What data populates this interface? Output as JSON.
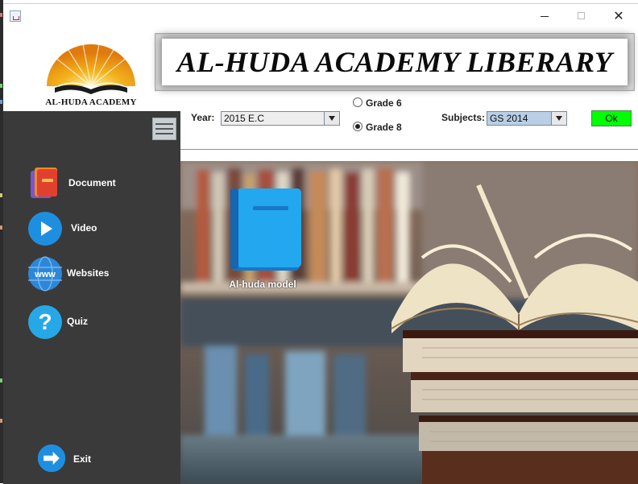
{
  "app": {
    "banner_title": "AL-HUDA ACADEMY LIBERARY",
    "logo_text": "AL-HUDA ACADEMY"
  },
  "window_controls": {
    "close_label": "✕"
  },
  "filters": {
    "year_label": "Year:",
    "year_value": "2015 E.C",
    "grades": [
      {
        "label": "Grade 6",
        "selected": false
      },
      {
        "label": "Grade 8",
        "selected": true
      }
    ],
    "subjects_label": "Subjects:",
    "subjects_value": "GS 2014",
    "ok_label": "Ok"
  },
  "sidebar": {
    "items": [
      {
        "label": "Document",
        "icon": "document-icon"
      },
      {
        "label": "Video",
        "icon": "play-icon"
      },
      {
        "label": "Websites",
        "icon": "www-globe-icon"
      },
      {
        "label": "Quiz",
        "icon": "question-icon"
      }
    ],
    "exit_label": "Exit"
  },
  "content": {
    "items": [
      {
        "label": "Al-huda model",
        "icon": "blue-book-icon"
      }
    ]
  },
  "colors": {
    "sidebar_bg": "#3a3a3a",
    "ok_button": "#00ff00",
    "book_blue": "#1e9be8"
  }
}
